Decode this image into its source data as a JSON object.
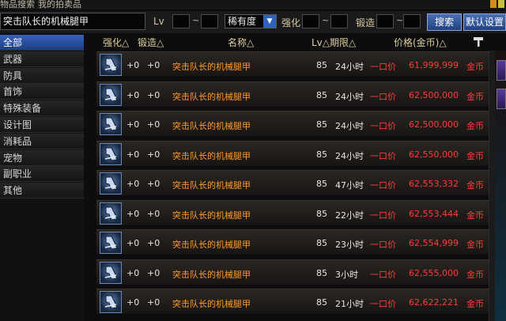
{
  "tabs": {
    "search": "物品搜索",
    "my_items": "我的拍卖品"
  },
  "search": {
    "value": "突击队长的机械腿甲",
    "lv_label": "Lv",
    "tilde": "~",
    "rarity_label": "稀有度",
    "enhance_label": "强化",
    "forge_label": "锻造",
    "search_button": "搜索",
    "default_button": "默认设置"
  },
  "sidebar": {
    "items": [
      "全部",
      "武器",
      "防具",
      "首饰",
      "特殊装备",
      "设计图",
      "消耗品",
      "宠物",
      "副职业",
      "其他"
    ],
    "active_index": 0
  },
  "headers": {
    "enhance": "强化△",
    "forge": "锻造△",
    "name": "名称△",
    "lv_dur": "Lv△期限△",
    "price": "价格(金币)△"
  },
  "colors": {
    "accent": "#2f5fb5",
    "name": "#ff9a2e",
    "price": "#ff3b3b"
  },
  "rows": [
    {
      "icon": "mechanical-leg-armor-icon",
      "enhance": "+0",
      "forge": "+0",
      "name": "突击队长的机械腿甲",
      "lv": "85",
      "duration": "24小时",
      "label": "一口价",
      "price": "61,999,999",
      "unit": "金币"
    },
    {
      "icon": "mechanical-leg-armor-icon",
      "enhance": "+0",
      "forge": "+0",
      "name": "突击队长的机械腿甲",
      "lv": "85",
      "duration": "24小时",
      "label": "一口价",
      "price": "62,500,000",
      "unit": "金币"
    },
    {
      "icon": "mechanical-leg-armor-icon",
      "enhance": "+0",
      "forge": "+0",
      "name": "突击队长的机械腿甲",
      "lv": "85",
      "duration": "24小时",
      "label": "一口价",
      "price": "62,500,000",
      "unit": "金币"
    },
    {
      "icon": "mechanical-leg-armor-icon",
      "enhance": "+0",
      "forge": "+0",
      "name": "突击队长的机械腿甲",
      "lv": "85",
      "duration": "24小时",
      "label": "一口价",
      "price": "62,550,000",
      "unit": "金币"
    },
    {
      "icon": "mechanical-leg-armor-icon",
      "enhance": "+0",
      "forge": "+0",
      "name": "突击队长的机械腿甲",
      "lv": "85",
      "duration": "47小时",
      "label": "一口价",
      "price": "62,553,332",
      "unit": "金币"
    },
    {
      "icon": "mechanical-leg-armor-icon",
      "enhance": "+0",
      "forge": "+0",
      "name": "突击队长的机械腿甲",
      "lv": "85",
      "duration": "22小时",
      "label": "一口价",
      "price": "62,553,444",
      "unit": "金币"
    },
    {
      "icon": "mechanical-leg-armor-icon",
      "enhance": "+0",
      "forge": "+0",
      "name": "突击队长的机械腿甲",
      "lv": "85",
      "duration": "23小时",
      "label": "一口价",
      "price": "62,554,999",
      "unit": "金币"
    },
    {
      "icon": "mechanical-leg-armor-icon",
      "enhance": "+0",
      "forge": "+0",
      "name": "突击队长的机械腿甲",
      "lv": "85",
      "duration": "3小时",
      "label": "一口价",
      "price": "62,555,000",
      "unit": "金币"
    },
    {
      "icon": "mechanical-leg-armor-icon",
      "enhance": "+0",
      "forge": "+0",
      "name": "突击队长的机械腿甲",
      "lv": "85",
      "duration": "21小时",
      "label": "一口价",
      "price": "62,622,221",
      "unit": "金币"
    }
  ]
}
